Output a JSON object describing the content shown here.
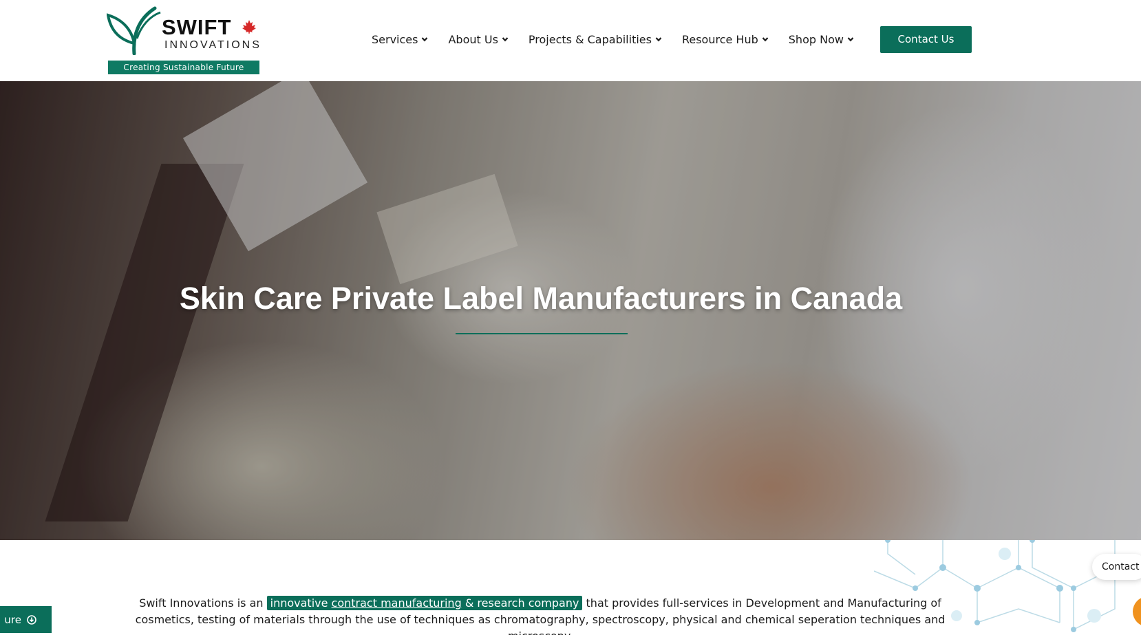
{
  "brand": {
    "name": "SWIFT",
    "subname": "INNOVATIONS",
    "tagline": "Creating Sustainable Future"
  },
  "nav": {
    "items": [
      {
        "label": "Services"
      },
      {
        "label": "About Us"
      },
      {
        "label": "Projects & Capabilities"
      },
      {
        "label": "Resource Hub"
      },
      {
        "label": "Shop Now"
      }
    ],
    "contact_label": "Contact Us"
  },
  "hero": {
    "title": "Skin Care Private Label Manufacturers in Canada"
  },
  "intro": {
    "before": "Swift Innovations is an",
    "highlight_pre": "innovative",
    "highlight_link": "contract manufacturing",
    "highlight_post": "& research company",
    "after": "that provides full-services in Development and Manufacturing of cosmetics, testing of materials through the use of techniques as chromatography, spectroscopy, physical and chemical seperation techniques and microscopy."
  },
  "floating": {
    "brochure_label": "ure",
    "contact_pill_label": "Contact"
  },
  "colors": {
    "brand_green": "#0b6e5a",
    "accent_orange": "#f0921e",
    "maple_red": "#d62828"
  },
  "icons": {
    "nav_chevron": "chevron-down-icon",
    "brochure": "download-circle-icon",
    "logo_leaf": "leaf-icon",
    "logo_maple": "maple-leaf-icon"
  }
}
